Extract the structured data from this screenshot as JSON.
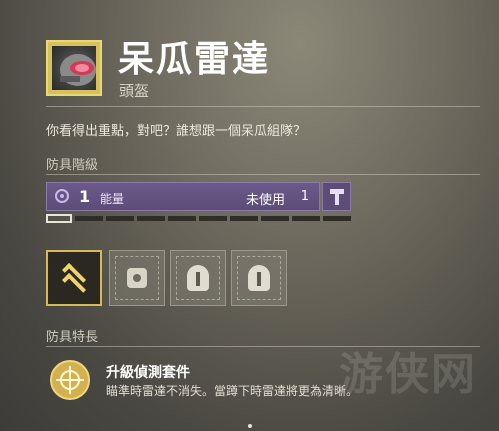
{
  "watermark": "游侠网",
  "item": {
    "name": "呆瓜雷達",
    "type": "頭盔",
    "flavor": "你看得出重點，對吧？誰想跟一個呆瓜組隊？",
    "icon": "helmet-icon"
  },
  "armor_tier": {
    "section_label": "防具階級",
    "energy_level": "1",
    "energy_label": "能量",
    "unused_label": "未使用",
    "unused_value": "1",
    "filled_pips": 1,
    "total_pips": 10,
    "energy_color": "#5b4c78",
    "upgrade_icon": "hammer-icon"
  },
  "mod_slots": [
    {
      "icon": "intrinsic-chevron-icon",
      "state": "active"
    },
    {
      "icon": "ward-mod-icon",
      "state": "empty"
    },
    {
      "icon": "helmet-mod-icon",
      "state": "empty"
    },
    {
      "icon": "helmet-mod-icon",
      "state": "empty"
    }
  ],
  "perks": {
    "section_label": "防具特長",
    "items": [
      {
        "name": "升級偵測套件",
        "description": "瞄準時雷達不消失。當蹲下時雷達將更為清晰。",
        "icon": "crosshair-icon"
      }
    ]
  },
  "colors": {
    "exotic_gold": "#d8c158",
    "energy_purple": "#5b4c78"
  }
}
